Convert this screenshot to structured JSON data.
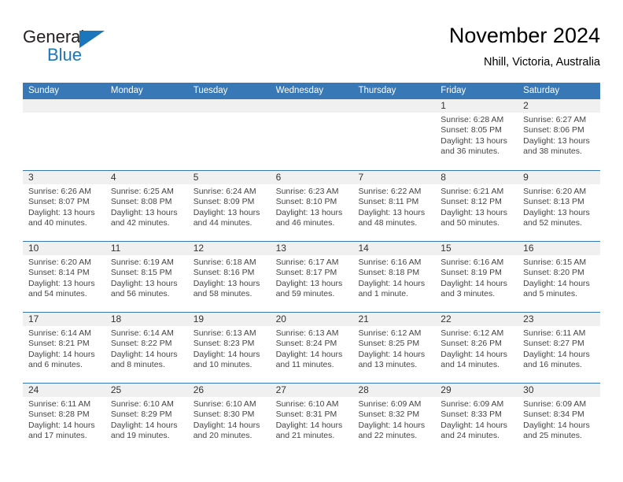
{
  "brand": {
    "word1": "General",
    "word2": "Blue",
    "logo_color": "#1b76bc",
    "triangle_icon": "triangle-icon"
  },
  "header": {
    "title": "November 2024",
    "subtitle": "Nhill, Victoria, Australia"
  },
  "calendar": {
    "header_color": "#3878b6",
    "daynum_bg": "#f0f0f0",
    "weekdays": [
      "Sunday",
      "Monday",
      "Tuesday",
      "Wednesday",
      "Thursday",
      "Friday",
      "Saturday"
    ],
    "weeks": [
      [
        {
          "empty": true
        },
        {
          "empty": true
        },
        {
          "empty": true
        },
        {
          "empty": true
        },
        {
          "empty": true
        },
        {
          "day": "1",
          "sunrise": "Sunrise: 6:28 AM",
          "sunset": "Sunset: 8:05 PM",
          "daylight1": "Daylight: 13 hours",
          "daylight2": "and 36 minutes."
        },
        {
          "day": "2",
          "sunrise": "Sunrise: 6:27 AM",
          "sunset": "Sunset: 8:06 PM",
          "daylight1": "Daylight: 13 hours",
          "daylight2": "and 38 minutes."
        }
      ],
      [
        {
          "day": "3",
          "sunrise": "Sunrise: 6:26 AM",
          "sunset": "Sunset: 8:07 PM",
          "daylight1": "Daylight: 13 hours",
          "daylight2": "and 40 minutes."
        },
        {
          "day": "4",
          "sunrise": "Sunrise: 6:25 AM",
          "sunset": "Sunset: 8:08 PM",
          "daylight1": "Daylight: 13 hours",
          "daylight2": "and 42 minutes."
        },
        {
          "day": "5",
          "sunrise": "Sunrise: 6:24 AM",
          "sunset": "Sunset: 8:09 PM",
          "daylight1": "Daylight: 13 hours",
          "daylight2": "and 44 minutes."
        },
        {
          "day": "6",
          "sunrise": "Sunrise: 6:23 AM",
          "sunset": "Sunset: 8:10 PM",
          "daylight1": "Daylight: 13 hours",
          "daylight2": "and 46 minutes."
        },
        {
          "day": "7",
          "sunrise": "Sunrise: 6:22 AM",
          "sunset": "Sunset: 8:11 PM",
          "daylight1": "Daylight: 13 hours",
          "daylight2": "and 48 minutes."
        },
        {
          "day": "8",
          "sunrise": "Sunrise: 6:21 AM",
          "sunset": "Sunset: 8:12 PM",
          "daylight1": "Daylight: 13 hours",
          "daylight2": "and 50 minutes."
        },
        {
          "day": "9",
          "sunrise": "Sunrise: 6:20 AM",
          "sunset": "Sunset: 8:13 PM",
          "daylight1": "Daylight: 13 hours",
          "daylight2": "and 52 minutes."
        }
      ],
      [
        {
          "day": "10",
          "sunrise": "Sunrise: 6:20 AM",
          "sunset": "Sunset: 8:14 PM",
          "daylight1": "Daylight: 13 hours",
          "daylight2": "and 54 minutes."
        },
        {
          "day": "11",
          "sunrise": "Sunrise: 6:19 AM",
          "sunset": "Sunset: 8:15 PM",
          "daylight1": "Daylight: 13 hours",
          "daylight2": "and 56 minutes."
        },
        {
          "day": "12",
          "sunrise": "Sunrise: 6:18 AM",
          "sunset": "Sunset: 8:16 PM",
          "daylight1": "Daylight: 13 hours",
          "daylight2": "and 58 minutes."
        },
        {
          "day": "13",
          "sunrise": "Sunrise: 6:17 AM",
          "sunset": "Sunset: 8:17 PM",
          "daylight1": "Daylight: 13 hours",
          "daylight2": "and 59 minutes."
        },
        {
          "day": "14",
          "sunrise": "Sunrise: 6:16 AM",
          "sunset": "Sunset: 8:18 PM",
          "daylight1": "Daylight: 14 hours",
          "daylight2": "and 1 minute."
        },
        {
          "day": "15",
          "sunrise": "Sunrise: 6:16 AM",
          "sunset": "Sunset: 8:19 PM",
          "daylight1": "Daylight: 14 hours",
          "daylight2": "and 3 minutes."
        },
        {
          "day": "16",
          "sunrise": "Sunrise: 6:15 AM",
          "sunset": "Sunset: 8:20 PM",
          "daylight1": "Daylight: 14 hours",
          "daylight2": "and 5 minutes."
        }
      ],
      [
        {
          "day": "17",
          "sunrise": "Sunrise: 6:14 AM",
          "sunset": "Sunset: 8:21 PM",
          "daylight1": "Daylight: 14 hours",
          "daylight2": "and 6 minutes."
        },
        {
          "day": "18",
          "sunrise": "Sunrise: 6:14 AM",
          "sunset": "Sunset: 8:22 PM",
          "daylight1": "Daylight: 14 hours",
          "daylight2": "and 8 minutes."
        },
        {
          "day": "19",
          "sunrise": "Sunrise: 6:13 AM",
          "sunset": "Sunset: 8:23 PM",
          "daylight1": "Daylight: 14 hours",
          "daylight2": "and 10 minutes."
        },
        {
          "day": "20",
          "sunrise": "Sunrise: 6:13 AM",
          "sunset": "Sunset: 8:24 PM",
          "daylight1": "Daylight: 14 hours",
          "daylight2": "and 11 minutes."
        },
        {
          "day": "21",
          "sunrise": "Sunrise: 6:12 AM",
          "sunset": "Sunset: 8:25 PM",
          "daylight1": "Daylight: 14 hours",
          "daylight2": "and 13 minutes."
        },
        {
          "day": "22",
          "sunrise": "Sunrise: 6:12 AM",
          "sunset": "Sunset: 8:26 PM",
          "daylight1": "Daylight: 14 hours",
          "daylight2": "and 14 minutes."
        },
        {
          "day": "23",
          "sunrise": "Sunrise: 6:11 AM",
          "sunset": "Sunset: 8:27 PM",
          "daylight1": "Daylight: 14 hours",
          "daylight2": "and 16 minutes."
        }
      ],
      [
        {
          "day": "24",
          "sunrise": "Sunrise: 6:11 AM",
          "sunset": "Sunset: 8:28 PM",
          "daylight1": "Daylight: 14 hours",
          "daylight2": "and 17 minutes."
        },
        {
          "day": "25",
          "sunrise": "Sunrise: 6:10 AM",
          "sunset": "Sunset: 8:29 PM",
          "daylight1": "Daylight: 14 hours",
          "daylight2": "and 19 minutes."
        },
        {
          "day": "26",
          "sunrise": "Sunrise: 6:10 AM",
          "sunset": "Sunset: 8:30 PM",
          "daylight1": "Daylight: 14 hours",
          "daylight2": "and 20 minutes."
        },
        {
          "day": "27",
          "sunrise": "Sunrise: 6:10 AM",
          "sunset": "Sunset: 8:31 PM",
          "daylight1": "Daylight: 14 hours",
          "daylight2": "and 21 minutes."
        },
        {
          "day": "28",
          "sunrise": "Sunrise: 6:09 AM",
          "sunset": "Sunset: 8:32 PM",
          "daylight1": "Daylight: 14 hours",
          "daylight2": "and 22 minutes."
        },
        {
          "day": "29",
          "sunrise": "Sunrise: 6:09 AM",
          "sunset": "Sunset: 8:33 PM",
          "daylight1": "Daylight: 14 hours",
          "daylight2": "and 24 minutes."
        },
        {
          "day": "30",
          "sunrise": "Sunrise: 6:09 AM",
          "sunset": "Sunset: 8:34 PM",
          "daylight1": "Daylight: 14 hours",
          "daylight2": "and 25 minutes."
        }
      ]
    ]
  }
}
